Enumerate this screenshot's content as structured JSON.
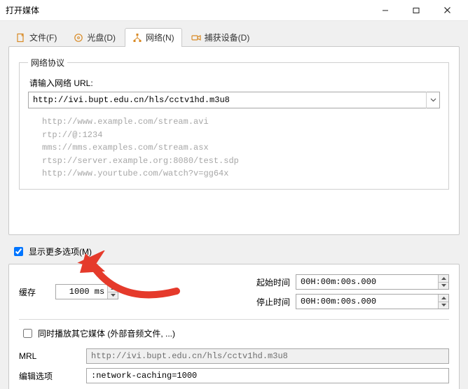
{
  "window": {
    "title": "打开媒体"
  },
  "tabs": {
    "file": {
      "label": "文件(F)"
    },
    "disc": {
      "label": "光盘(D)"
    },
    "network": {
      "label": "网络(N)"
    },
    "capture": {
      "label": "捕获设备(D)"
    }
  },
  "network_panel": {
    "group_title": "网络协议",
    "url_label": "请输入网络 URL:",
    "url_value": "http://ivi.bupt.edu.cn/hls/cctv1hd.m3u8",
    "examples": [
      "http://www.example.com/stream.avi",
      "rtp://@:1234",
      "mms://mms.examples.com/stream.asx",
      "rtsp://server.example.org:8080/test.sdp",
      "http://www.yourtube.com/watch?v=gg64x"
    ]
  },
  "more": {
    "show_more_label": "显示更多选项(M)",
    "show_more_checked": true,
    "cache_label": "缓存",
    "cache_value": "1000 ms",
    "start_time_label": "起始时间",
    "start_time_value": "00H:00m:00s.000",
    "stop_time_label": "停止时间",
    "stop_time_value": "00H:00m:00s.000",
    "play_another_label": "同时播放其它媒体 (外部音频文件, ...)",
    "play_another_checked": false,
    "mrl_label": "MRL",
    "mrl_value": "http://ivi.bupt.edu.cn/hls/cctv1hd.m3u8",
    "edit_opts_label": "编辑选项",
    "edit_opts_value": ":network-caching=1000"
  },
  "colors": {
    "arrow": "#e53a2b"
  }
}
